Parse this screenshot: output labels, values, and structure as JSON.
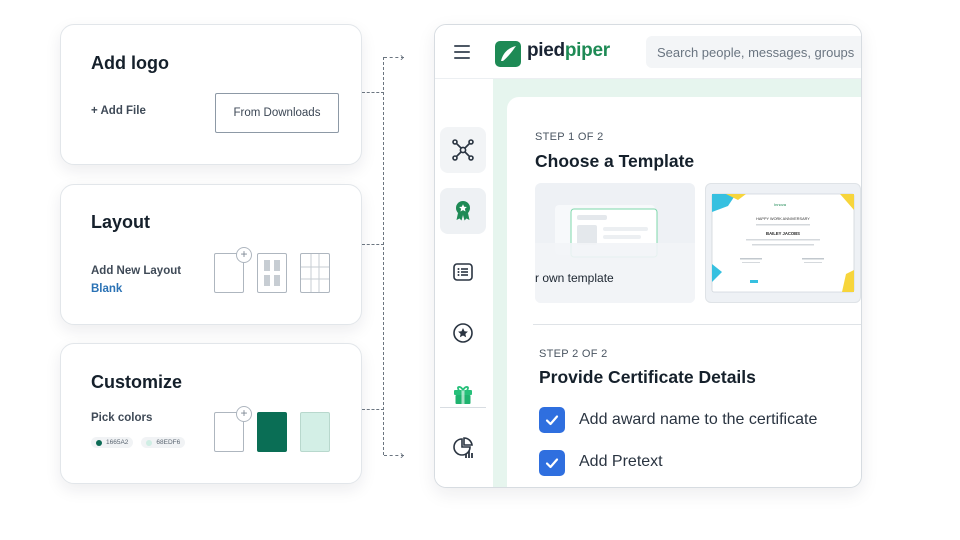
{
  "cards": {
    "logo": {
      "title": "Add logo",
      "add_file": "+ Add File",
      "from_downloads": "From Downloads"
    },
    "layout": {
      "title": "Layout",
      "add_new": "Add New Layout",
      "blank": "Blank"
    },
    "customize": {
      "title": "Customize",
      "pick_colors": "Pick colors",
      "swatches": [
        {
          "hex_label": "1665A2",
          "color": "#0c6b55"
        },
        {
          "hex_label": "68EDF6",
          "color": "#cfeee4"
        }
      ],
      "primary_color": "#0a6e55",
      "secondary_color": "#d3efe6"
    }
  },
  "app": {
    "brand_part1": "pied",
    "brand_part2": "piper",
    "search_placeholder": "Search people, messages, groups",
    "accent": "#1e8a55",
    "sidebar_icons": [
      "network-icon",
      "award-badge-icon",
      "list-icon",
      "star-circle-icon",
      "gift-icon",
      "analytics-icon"
    ],
    "step1": {
      "label": "STEP 1 OF 2",
      "title": "Choose a Template",
      "own_template": "r own template"
    },
    "cert": {
      "brand": "Innova",
      "heading": "HAPPY WORK ANNIVERSARY",
      "name": "BAILEY JACOBS"
    },
    "step2": {
      "label": "STEP 2 OF 2",
      "title": "Provide Certificate Details",
      "options": [
        {
          "label": "Add award name to the certificate",
          "checked": true
        },
        {
          "label": "Add Pretext",
          "checked": true
        }
      ]
    }
  }
}
